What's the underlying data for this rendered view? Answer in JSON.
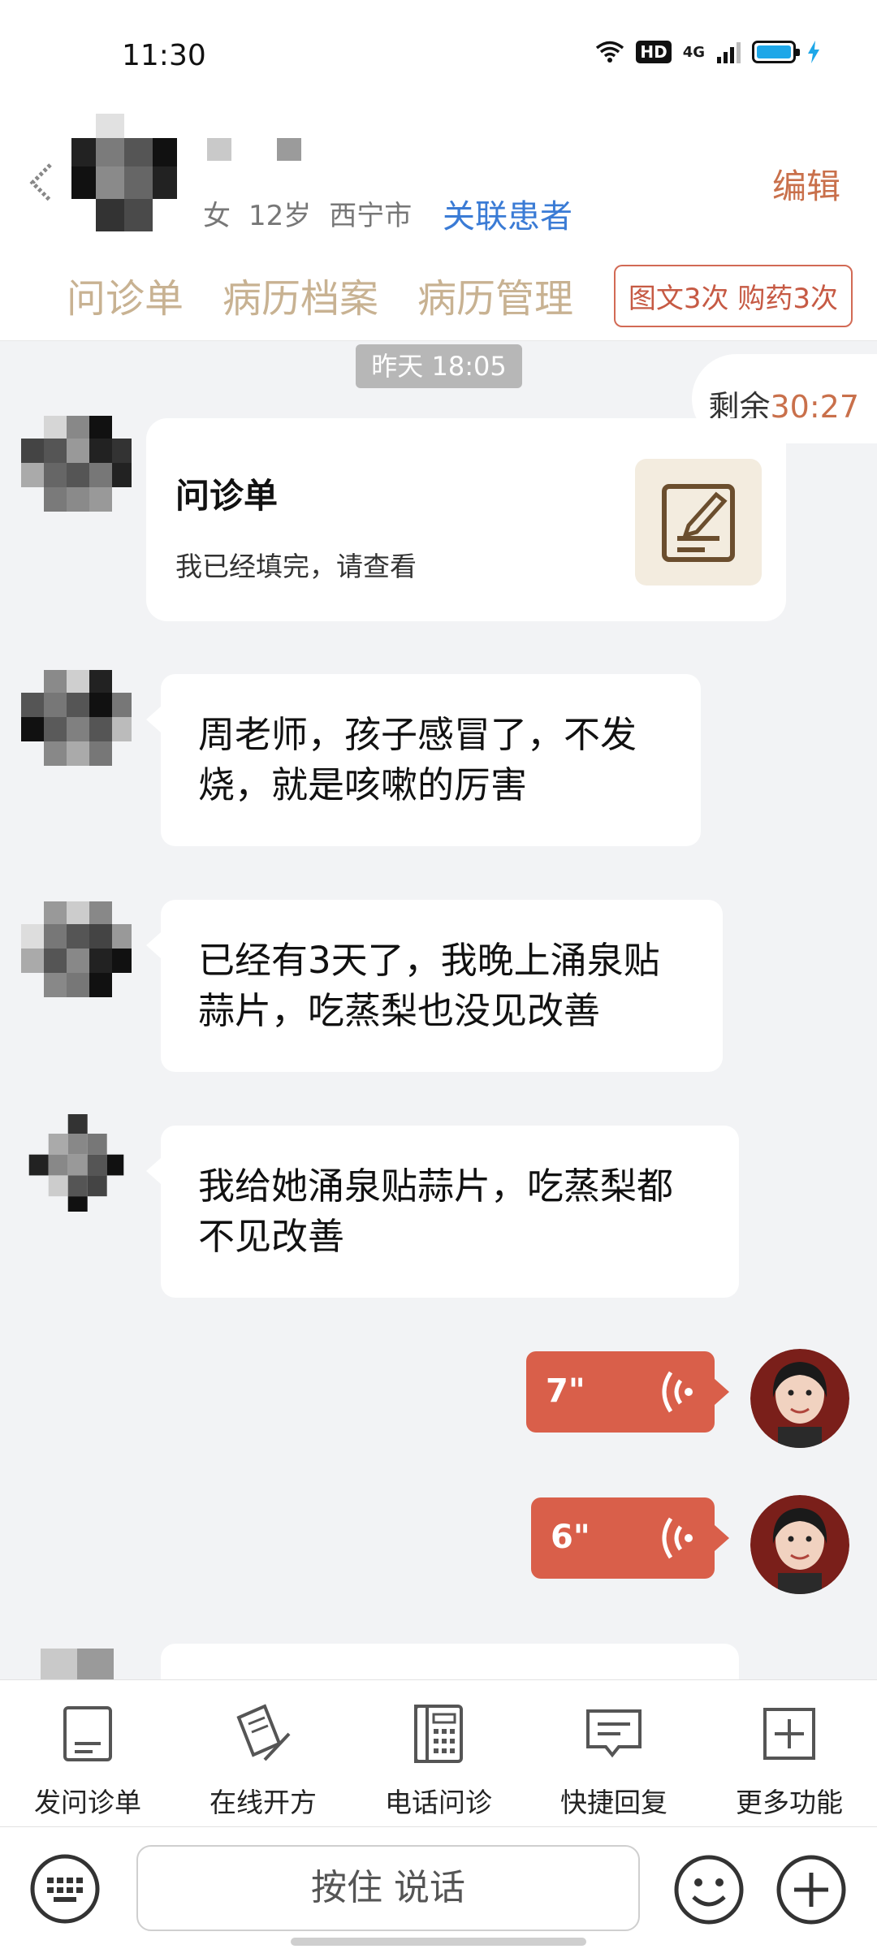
{
  "status_bar": {
    "time": "11:30",
    "hd": "HD",
    "network": "4G",
    "battery_color": "#1ea7e8"
  },
  "header": {
    "back_icon": "back-arrow-icon",
    "gender": "女",
    "age": "12岁",
    "city": "西宁市",
    "link_patient": "关联患者",
    "edit": "编辑",
    "tabs": [
      {
        "label": "问诊单"
      },
      {
        "label": "病历档案"
      },
      {
        "label": "病历管理"
      }
    ],
    "quota_badge": "图文3次 购药3次"
  },
  "chat": {
    "timestamp": "昨天 18:05",
    "remaining_label": "剩余",
    "remaining_time": "30:27",
    "card": {
      "title": "问诊单",
      "subtitle": "我已经填完，请查看",
      "icon": "form-edit-icon"
    },
    "messages": [
      {
        "text": "周老师，孩子感冒了，不发烧，就是咳嗽的厉害"
      },
      {
        "text": "已经有3天了，我晚上涌泉贴蒜片，吃蒸梨也没见改善"
      },
      {
        "text": "我给她涌泉贴蒜片，吃蒸梨都不见改善"
      }
    ],
    "voice_messages": [
      {
        "duration": "7\""
      },
      {
        "duration": "6\""
      }
    ]
  },
  "toolbar": {
    "items": [
      {
        "label": "发问诊单",
        "icon": "form-icon"
      },
      {
        "label": "在线开方",
        "icon": "prescription-icon"
      },
      {
        "label": "电话问诊",
        "icon": "phone-icon"
      },
      {
        "label": "快捷回复",
        "icon": "quick-reply-icon"
      },
      {
        "label": "更多功能",
        "icon": "plus-square-icon"
      }
    ]
  },
  "input_bar": {
    "talk_label": "按住 说话"
  },
  "colors": {
    "accent": "#c9704b",
    "voice_bubble": "#d95f4a",
    "link": "#3a7bd5",
    "tab": "#c8b292"
  }
}
